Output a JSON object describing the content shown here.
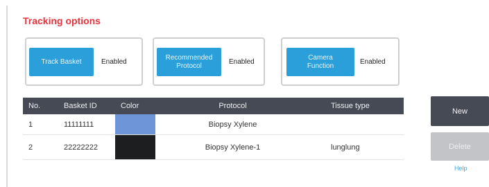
{
  "section": {
    "title": "Tracking options"
  },
  "options": [
    {
      "label": "Track Basket",
      "state": "Enabled"
    },
    {
      "label": "Recommended\nProtocol",
      "state": "Enabled"
    },
    {
      "label": "Camera\nFunction",
      "state": "Enabled"
    }
  ],
  "table": {
    "headers": {
      "no": "No.",
      "basket_id": "Basket ID",
      "color": "Color",
      "protocol": "Protocol",
      "tissue": "Tissue type"
    },
    "rows": [
      {
        "no": "1",
        "basket_id": "11111111",
        "color": "#6d95d8",
        "protocol": "Biopsy Xylene",
        "tissue": ""
      },
      {
        "no": "2",
        "basket_id": "22222222",
        "color": "#1c1e20",
        "protocol": "Biopsy Xylene-1",
        "tissue": "lunglung"
      }
    ]
  },
  "actions": {
    "new_label": "New",
    "delete_label": "Delete",
    "help_label": "Help"
  },
  "colors": {
    "accent": "#2b9fd9",
    "title": "#e8323c",
    "header": "#464a55"
  }
}
